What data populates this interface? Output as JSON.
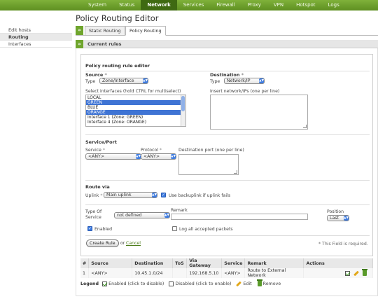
{
  "nav": {
    "items": [
      "System",
      "Status",
      "Network",
      "Services",
      "Firewall",
      "Proxy",
      "VPN",
      "Hotspot",
      "Logs"
    ],
    "active": "Network"
  },
  "page": {
    "title": "Policy Routing Editor"
  },
  "sidebar": {
    "items": [
      {
        "label": "Edit hosts",
        "active": false
      },
      {
        "label": "Routing",
        "active": true
      },
      {
        "label": "Interfaces",
        "active": false
      }
    ]
  },
  "tabs": {
    "items": [
      "Static Routing",
      "Policy Routing"
    ],
    "active": "Policy Routing"
  },
  "section": {
    "title": "Current rules"
  },
  "editor": {
    "title": "Policy routing rule editor",
    "source": {
      "label": "Source",
      "required_mark": "*",
      "type_label": "Type",
      "type_value": "Zone/Interface",
      "select_hint": "Select interfaces (hold CTRL for multiselect)",
      "options": [
        {
          "label": "LOCAL",
          "selected": false
        },
        {
          "label": "GREEN",
          "selected": true
        },
        {
          "label": "BLUE",
          "selected": false
        },
        {
          "label": "ORANGE",
          "selected": true
        },
        {
          "label": "Interface 1 (Zone: GREEN)",
          "selected": false
        },
        {
          "label": "Interface 4 (Zone: ORANGE)",
          "selected": false
        }
      ]
    },
    "destination": {
      "label": "Destination",
      "required_mark": "*",
      "type_label": "Type",
      "type_value": "Network/IP",
      "insert_hint": "Insert network/IPs (one per line)"
    },
    "service": {
      "title": "Service/Port",
      "service_label": "Service",
      "service_value": "<ANY>",
      "protocol_label": "Protocol",
      "protocol_value": "<ANY>",
      "dest_port_label": "Destination port (one per line)",
      "required_mark": "*"
    },
    "route": {
      "title": "Route via",
      "uplink_label": "Uplink",
      "uplink_required": "*",
      "uplink_value": "Main uplink",
      "backup_label": "Use backuplink if uplink fails",
      "backup_checked": true
    },
    "tos": {
      "label": "Type Of Service",
      "value": "not defined",
      "remark_label": "Remark",
      "remark_value": "",
      "position_label": "Position",
      "position_value": "Last"
    },
    "enabled_label": "Enabled",
    "enabled_checked": true,
    "log_label": "Log all accepted packets",
    "log_checked": false,
    "create_label": "Create Rule",
    "or_label": "or",
    "cancel_label": "Cancel",
    "required_note": "* This Field is required."
  },
  "table": {
    "headers": [
      "#",
      "Source",
      "Destination",
      "ToS",
      "Via Gateway",
      "Service",
      "Remark",
      "Actions"
    ],
    "rows": [
      {
        "num": "1",
        "source": "<ANY>",
        "destination": "10.45.1.0/24",
        "tos": "",
        "gateway": "192.168.5.10",
        "service": "<ANY>",
        "remark": "Route to External Network"
      }
    ]
  },
  "legend": {
    "title": "Legend",
    "enabled": "Enabled (click to disable)",
    "disabled": "Disabled (click to enable)",
    "edit": "Edit",
    "remove": "Remove"
  },
  "colors": {
    "nav_green": "#6fa52d",
    "nav_active": "#3f6a12",
    "selection_blue": "#3f74d4",
    "link_green": "#4a7a16"
  }
}
